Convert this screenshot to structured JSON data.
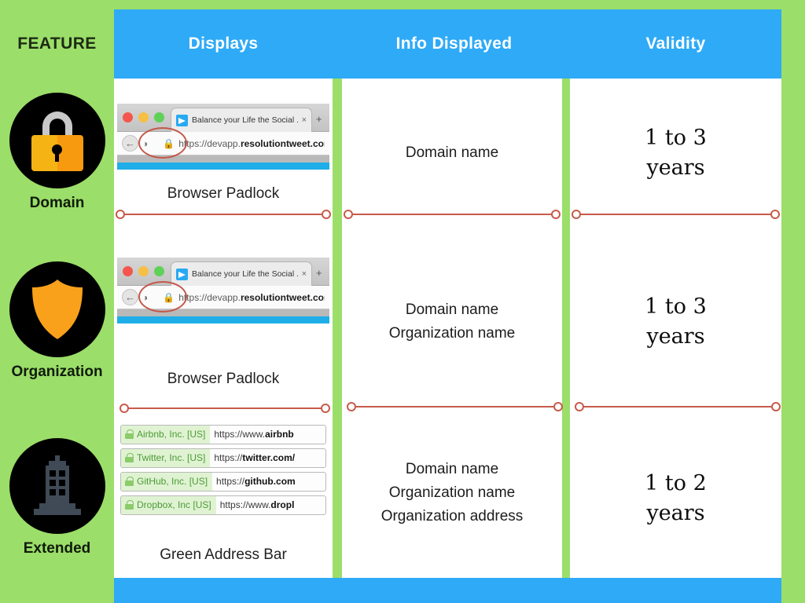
{
  "theme": {
    "background_green": "#9BDE69",
    "header_blue": "#2FAAF7",
    "panel_white": "#FFFFFF",
    "separator_red": "#C75B4A",
    "padlock_orange": "#F5B314",
    "shield_orange": "#F9A11B",
    "building_gray": "#3F4A56",
    "ev_green_text": "#4E9A38"
  },
  "feature_header": "FEATURE",
  "columns": [
    {
      "label": "Displays"
    },
    {
      "label": "Info Displayed"
    },
    {
      "label": "Validity"
    }
  ],
  "rows": [
    {
      "feature_name": "Domain",
      "icon": "padlock-icon",
      "display_caption": "Browser Padlock",
      "display_type": "browser-mock",
      "info_lines": [
        "Domain name"
      ],
      "validity": "1 to 3\nyears",
      "validity_line1": "1 to 3",
      "validity_line2": "years"
    },
    {
      "feature_name": "Organization",
      "icon": "shield-icon",
      "display_caption": "Browser Padlock",
      "display_type": "browser-mock",
      "info_lines": [
        "Domain name",
        "Organization name"
      ],
      "validity_line1": "1 to 3",
      "validity_line2": "years"
    },
    {
      "feature_name": "Extended",
      "icon": "building-icon",
      "display_caption": "Green Address Bar",
      "display_type": "ev-address-bar",
      "info_lines": [
        "Domain name",
        "Organization name",
        "Organization address"
      ],
      "validity_line1": "1 to 2",
      "validity_line2": "years"
    }
  ],
  "browser_mock": {
    "tab_title": "Balance your Life the Social ...",
    "tab_close": "×",
    "new_tab": "+",
    "back_arrow": "←",
    "shield_glyph": "◑",
    "lock_glyph": "🔒",
    "url_prefix": "https://devapp.",
    "url_domain": "resolutiontweet.com"
  },
  "ev_address_bar": {
    "rows": [
      {
        "org": "Airbnb, Inc. [US]",
        "url_prefix": "https://www.",
        "url_domain": "airbnb"
      },
      {
        "org": "Twitter, Inc. [US]",
        "url_prefix": "https://",
        "url_domain": "twitter.com/"
      },
      {
        "org": "GitHub, Inc. [US]",
        "url_prefix": "https://",
        "url_domain": "github.com"
      },
      {
        "org": "Dropbox, Inc [US]",
        "url_prefix": "https://www.",
        "url_domain": "dropl"
      }
    ]
  }
}
